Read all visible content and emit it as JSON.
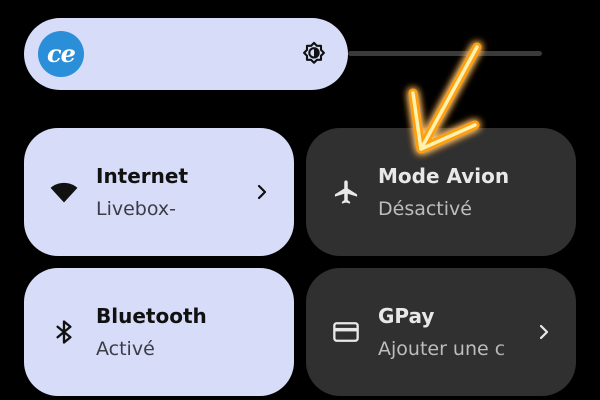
{
  "brightness": {
    "logo_text": "ce",
    "icon": "auto-brightness-icon"
  },
  "tiles": [
    {
      "title": "Internet",
      "subtitle": "Livebox-",
      "icon": "wifi-icon",
      "has_chevron": true,
      "state": "on"
    },
    {
      "title": "Mode Avion",
      "subtitle": "Désactivé",
      "icon": "airplane-icon",
      "has_chevron": false,
      "state": "off"
    },
    {
      "title": "Bluetooth",
      "subtitle": "Activé",
      "icon": "bluetooth-icon",
      "has_chevron": false,
      "state": "on"
    },
    {
      "title": "GPay",
      "subtitle": "Ajouter une c",
      "icon": "credit-card-icon",
      "has_chevron": true,
      "state": "off"
    }
  ],
  "colors": {
    "background": "#000000",
    "tile_on": "#d7dcf8",
    "tile_off": "#303030",
    "logo": "#2a8fd8",
    "annotation_arrow": "#ffb020"
  }
}
